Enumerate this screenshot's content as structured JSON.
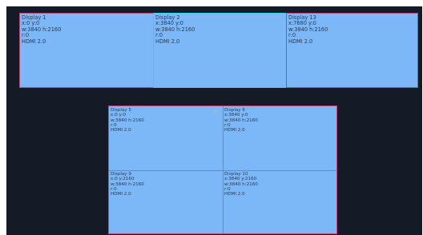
{
  "top_row": [
    {
      "name": "Display 1",
      "pos": "x:0  y:0",
      "size": "w:3840  h:2160",
      "rotation": "r:0",
      "port": "HDMI 2.0"
    },
    {
      "name": "Display 2",
      "pos": "x:3840  y:0",
      "size": "w:3840  h:2160",
      "rotation": "r:0",
      "port": "HDMI 2.0"
    },
    {
      "name": "Display 13",
      "pos": "x:7680  y:0",
      "size": "w:3840  h:2160",
      "rotation": "r:0",
      "port": "HDMI 2.0"
    }
  ],
  "bottom_grid": [
    {
      "name": "Display 5",
      "pos": "x:0  y:0",
      "size": "w:3840  h:2160",
      "rotation": "r:0",
      "port": "HDMI 2.0"
    },
    {
      "name": "Display 6",
      "pos": "x:3840  y:0",
      "size": "w:3840  h:2160",
      "rotation": "r:0",
      "port": "HDMI 2.0"
    },
    {
      "name": "Display 9",
      "pos": "x:0  y:2160",
      "size": "w:3840  h:2160",
      "rotation": "r:0",
      "port": "HDMI 2.0"
    },
    {
      "name": "Display 10",
      "pos": "x:3840  y:2160",
      "size": "w:3840  h:2160",
      "rotation": "r:0",
      "port": "HDMI 2.0"
    }
  ],
  "close_icon": "close-icon",
  "colors": {
    "canvas": "#141a26",
    "panel": "#7cb8f7",
    "panel_border": "#b5477a",
    "selected_border": "#33d0e0"
  }
}
